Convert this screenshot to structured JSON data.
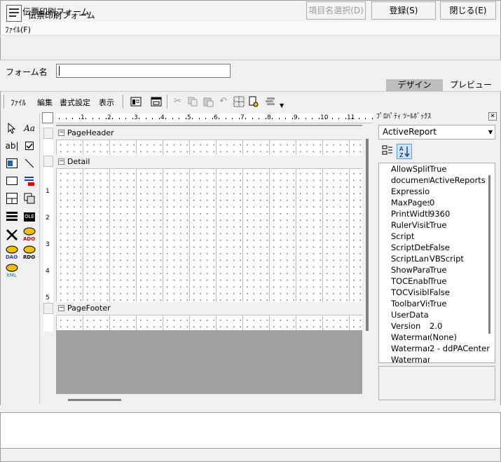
{
  "window": {
    "title": "伝票印刷フォーム",
    "min": "—",
    "max": "☐",
    "close": "✕"
  },
  "menu": {
    "file": "ﾌｧｲﾙ(F)"
  },
  "header": {
    "title": "伝票印刷フォーム",
    "field_select_button": "項目名選択(D)",
    "register_button": "登録(S)",
    "close_button": "閉じる(E)"
  },
  "form_name": {
    "label": "フォーム名",
    "value": ""
  },
  "view_tabs": {
    "design": "デザイン",
    "preview": "プレビュー"
  },
  "toolbar": {
    "file": "ﾌｧｲﾙ",
    "edit": "編集",
    "format": "書式設定",
    "view": "表示"
  },
  "toolbox": {
    "text_tool": "Aa",
    "label_tool": "ab|",
    "ole_tool": "OLE",
    "ado_label": "ADO",
    "dao_label": "DAO",
    "rdo_label": "RDO",
    "xml_label": "XML"
  },
  "rulers": {
    "horizontal": [
      "1",
      "2",
      "3",
      "4",
      "5",
      "6",
      "7",
      "8",
      "9",
      "10",
      "11",
      "1"
    ],
    "vertical": [
      "1",
      "2",
      "3",
      "4",
      "5"
    ]
  },
  "bands": {
    "page_header": "PageHeader",
    "detail": "Detail",
    "page_footer": "PageFooter"
  },
  "properties": {
    "panel_title": "ﾌﾟﾛﾊﾟﾃｨ ﾂｰﾙﾎﾞｯｸｽ",
    "close": "✕",
    "object": "ActiveReport",
    "rows": [
      {
        "name": "AllowSplit",
        "value": "True"
      },
      {
        "name": "documentName",
        "value": "ActiveReports"
      },
      {
        "name": "Expression",
        "value": ""
      },
      {
        "name": "MaxPages",
        "value": "0"
      },
      {
        "name": "PrintWidth",
        "value": "9360"
      },
      {
        "name": "RulerVisible",
        "value": "True"
      },
      {
        "name": "Script",
        "value": ""
      },
      {
        "name": "ScriptDebug",
        "value": "False"
      },
      {
        "name": "ScriptLanguage",
        "value": "VBScript"
      },
      {
        "name": "ShowParameter",
        "value": "True"
      },
      {
        "name": "TOCEnabled",
        "value": "True"
      },
      {
        "name": "TOCVisible",
        "value": "False"
      },
      {
        "name": "ToolbarVisible",
        "value": "True"
      },
      {
        "name": "UserData",
        "value": ""
      },
      {
        "name": "Version",
        "value": "2.0"
      },
      {
        "name": "Watermark",
        "value": "(None)"
      },
      {
        "name": "Watermark",
        "value": "2 - ddPACenter"
      },
      {
        "name": "Watermark",
        "value": ""
      }
    ]
  },
  "colors": {
    "selected_tab": "#bdbdbd",
    "surface_bg": "#a0a0a0"
  }
}
